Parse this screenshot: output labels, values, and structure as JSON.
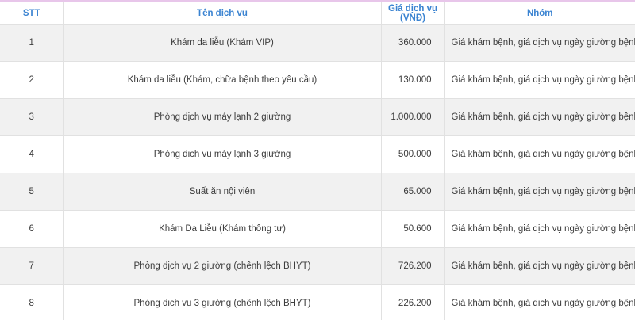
{
  "table": {
    "headers": {
      "stt": "STT",
      "service": "Tên dịch vụ",
      "price_line1": "Giá dịch vụ",
      "price_line2": "(VNĐ)",
      "group": "Nhóm"
    },
    "rows": [
      {
        "stt": "1",
        "service": "Khám da liễu (Khám VIP)",
        "price": "360.000",
        "group": "Giá khám bệnh, giá dịch vụ ngày giường bệnh"
      },
      {
        "stt": "2",
        "service": "Khám da liễu (Khám, chữa bệnh theo yêu cầu)",
        "price": "130.000",
        "group": "Giá khám bệnh, giá dịch vụ ngày giường bệnh"
      },
      {
        "stt": "3",
        "service": "Phòng dịch vụ máy lạnh 2 giường",
        "price": "1.000.000",
        "group": "Giá khám bệnh, giá dịch vụ ngày giường bệnh"
      },
      {
        "stt": "4",
        "service": "Phòng dịch vụ máy lạnh 3 giường",
        "price": "500.000",
        "group": "Giá khám bệnh, giá dịch vụ ngày giường bệnh"
      },
      {
        "stt": "5",
        "service": "Suất ăn nội viên",
        "price": "65.000",
        "group": "Giá khám bệnh, giá dịch vụ ngày giường bệnh"
      },
      {
        "stt": "6",
        "service": "Khám Da Liễu (Khám thông tư)",
        "price": "50.600",
        "group": "Giá khám bệnh, giá dịch vụ ngày giường bệnh"
      },
      {
        "stt": "7",
        "service": "Phòng dịch vụ 2 giường (chênh lệch BHYT)",
        "price": "726.200",
        "group": "Giá khám bệnh, giá dịch vụ ngày giường bệnh"
      },
      {
        "stt": "8",
        "service": "Phòng dịch vụ 3 giường (chênh lệch BHYT)",
        "price": "226.200",
        "group": "Giá khám bệnh, giá dịch vụ ngày giường bệnh"
      }
    ]
  }
}
